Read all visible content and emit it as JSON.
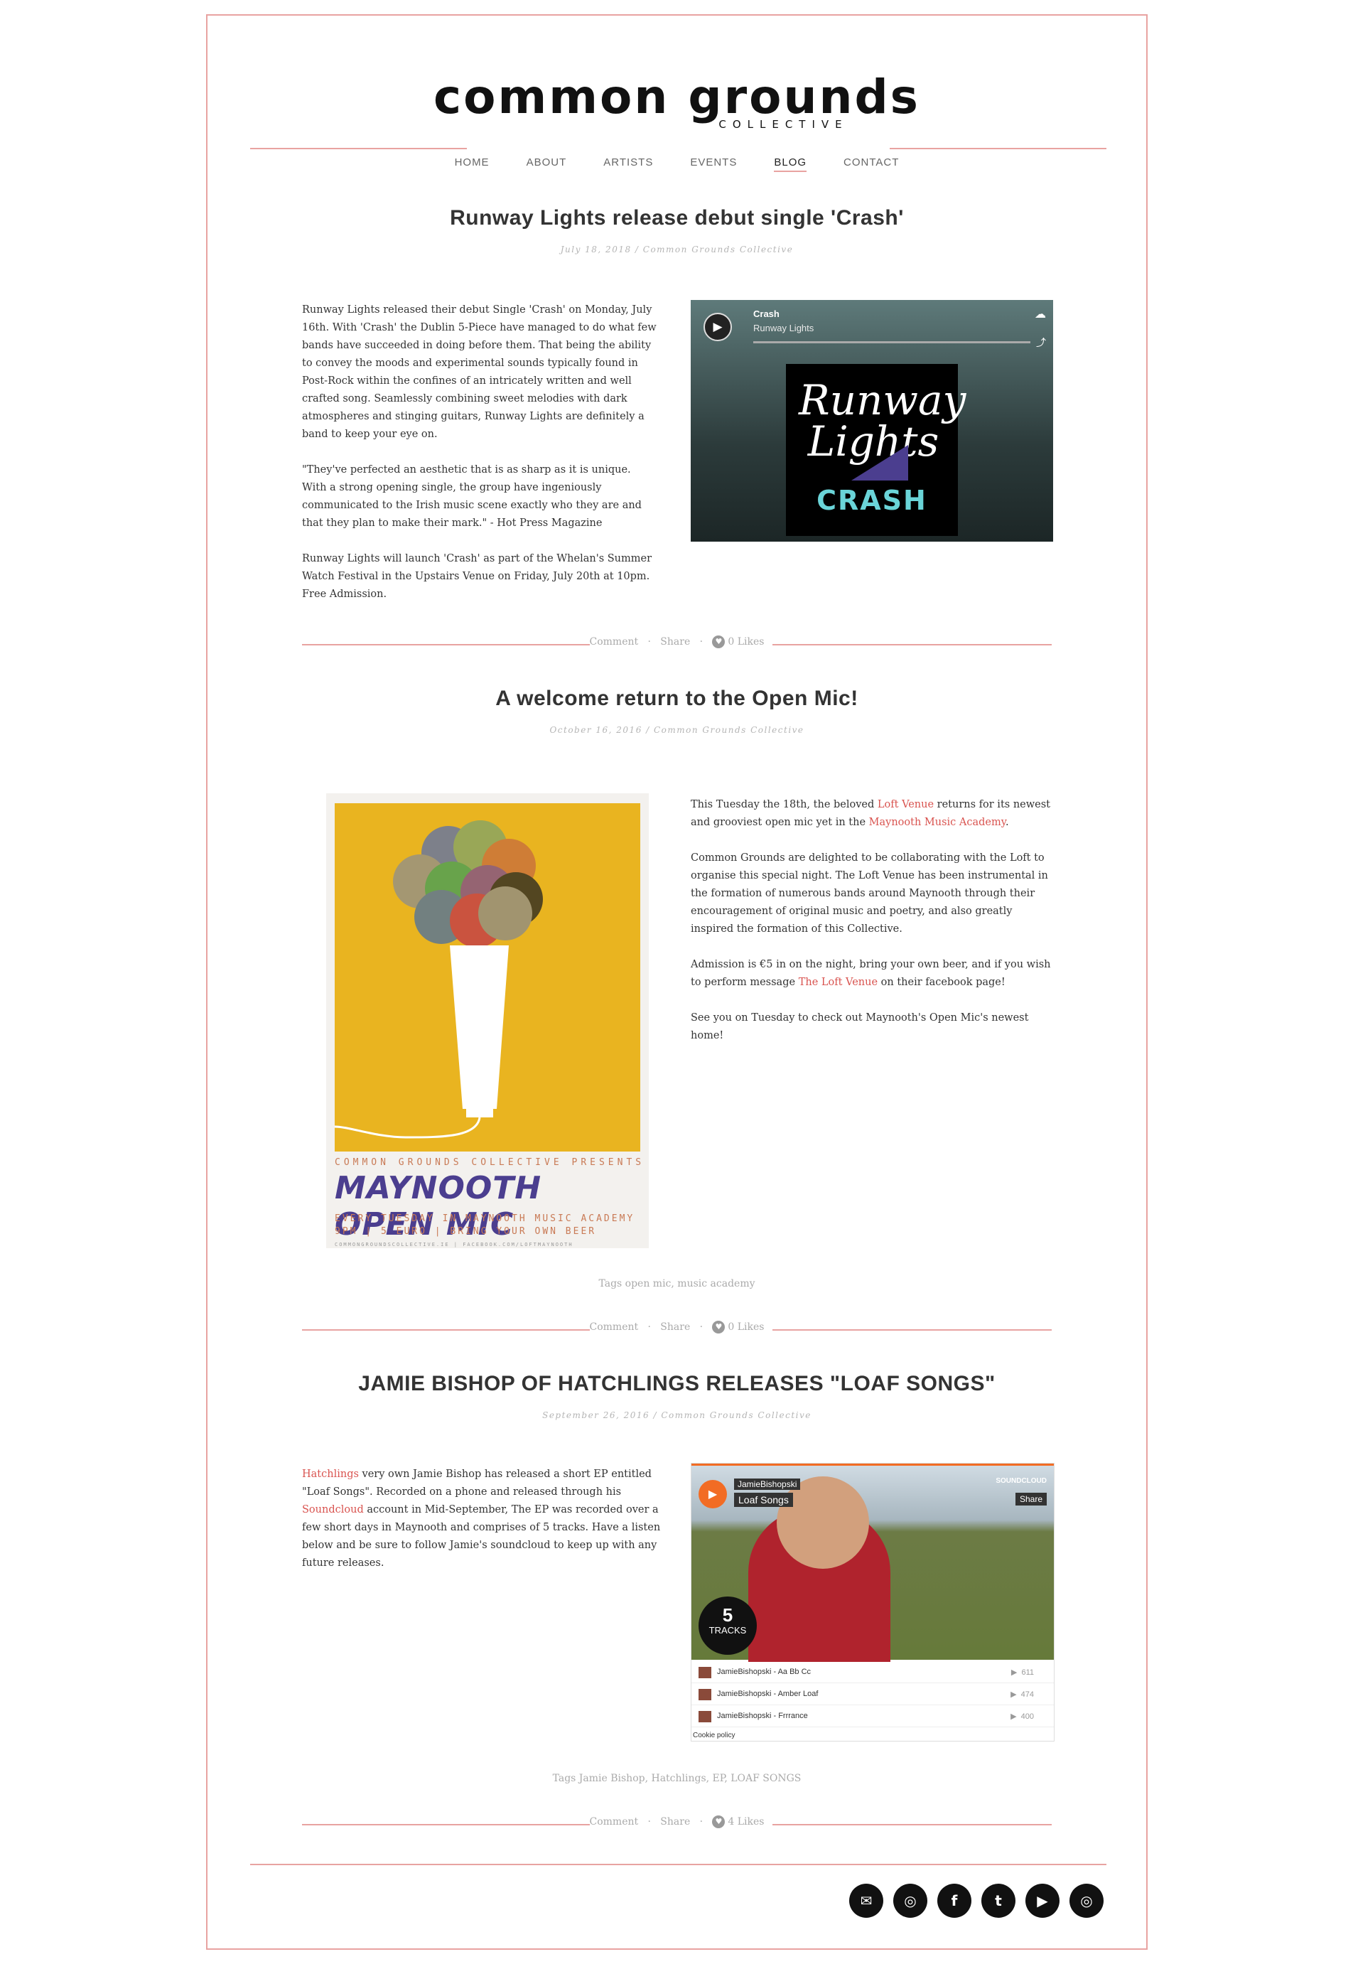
{
  "header": {
    "logo_main": "common grounds",
    "logo_sub": "COLLECTIVE",
    "nav": [
      "HOME",
      "ABOUT",
      "ARTISTS",
      "EVENTS",
      "BLOG",
      "CONTACT"
    ],
    "active_nav": "BLOG"
  },
  "colors": {
    "accent": "#e8a3a1",
    "link": "#d9534f"
  },
  "posts": [
    {
      "title": "Runway Lights release debut single 'Crash'",
      "meta": "July 18, 2018 / Common Grounds Collective",
      "paragraphs": [
        "Runway Lights released their debut Single 'Crash' on Monday, July 16th. With 'Crash' the Dublin 5-Piece have managed to do what few bands have succeeded in doing before them. That being the ability to convey the moods and experimental sounds typically found in Post-Rock within the confines of an intricately written and well crafted song. Seamlessly combining sweet melodies with dark atmospheres and stinging guitars, Runway Lights are definitely a band to keep your eye on.",
        "\"They've perfected an aesthetic that is as sharp as it is unique. With a strong opening single, the group have ingeniously communicated to the Irish music scene exactly who they are and that they plan to make their mark.\" - Hot Press Magazine",
        "Runway Lights will launch 'Crash' as part of the Whelan's Summer Watch Festival in the Upstairs Venue on Friday, July 20th at 10pm. Free Admission."
      ],
      "embed": {
        "track": "Crash",
        "artist": "Runway Lights",
        "art_band": "Runway Lights",
        "art_title": "CRASH"
      },
      "actions": {
        "comment": "Comment",
        "share": "Share",
        "likes": "0 Likes"
      }
    },
    {
      "title": "A welcome return to the Open Mic!",
      "meta": "October 16, 2016 / Common Grounds Collective",
      "p1_a": "This Tuesday the 18th, the beloved ",
      "p1_link1": "Loft Venue",
      "p1_b": " returns for its newest and grooviest open mic yet in the ",
      "p1_link2": "Maynooth Music Academy",
      "p1_c": ".",
      "p2": "Common Grounds are delighted to be collaborating with the Loft to organise this special night.  The Loft Venue has been instrumental in the formation of numerous bands around Maynooth through their encouragement of original music and poetry, and also greatly inspired the formation of this Collective.",
      "p3_a": "Admission is €5 in on the night, bring your own beer, and if you wish to perform message ",
      "p3_link": "The Loft Venue",
      "p3_b": " on their facebook page!",
      "p4": "See you on Tuesday to check out Maynooth's Open Mic's newest home!",
      "poster": {
        "presents": "COMMON GROUNDS COLLECTIVE PRESENTS",
        "title": "MAYNOOTH OPEN MIC",
        "line1": "EVERY TUESDAY IN MAYNOOTH MUSIC ACADEMY",
        "line2": "9PM | 5 EURO | BRING YOUR OWN BEER",
        "line3": "COMMONGROUNDSCOLLECTIVE.IE   |   FACEBOOK.COM/LOFTMAYNOOTH"
      },
      "tags": "Tags open mic, music academy",
      "actions": {
        "comment": "Comment",
        "share": "Share",
        "likes": "0 Likes"
      }
    },
    {
      "title": "JAMIE BISHOP OF HATCHLINGS RELEASES \"LOAF SONGS\"",
      "meta": "September 26, 2016 / Common Grounds Collective",
      "p1_link1": "Hatchlings",
      "p1_a": " very own Jamie Bishop has released a short EP entitled \"Loaf Songs\". Recorded on a phone and released through his ",
      "p1_link2": "Soundcloud",
      "p1_b": " account in Mid-September, The EP was recorded over a few short days in Maynooth and comprises of 5 tracks. Have a listen below and be sure to follow Jamie's soundcloud to keep up with any future releases.",
      "embed": {
        "user": "JamieBishopski",
        "playlist": "Loaf Songs",
        "brand": "SOUNDCLOUD",
        "share": "Share",
        "track_count": "5",
        "track_label": "TRACKS",
        "tracks": [
          {
            "name": "JamieBishopski - Aa Bb Cc",
            "plays": "611"
          },
          {
            "name": "JamieBishopski - Amber Loaf",
            "plays": "474"
          },
          {
            "name": "JamieBishopski - Frrrance",
            "plays": "400"
          }
        ],
        "cookie": "Cookie policy"
      },
      "tags": "Tags Jamie Bishop, Hatchlings, EP, LOAF SONGS",
      "actions": {
        "comment": "Comment",
        "share": "Share",
        "likes": "4 Likes"
      }
    }
  ],
  "footer": {
    "social": [
      "email-icon",
      "instagram-icon",
      "facebook-icon",
      "twitter-icon",
      "youtube-icon",
      "instagram-icon"
    ]
  }
}
